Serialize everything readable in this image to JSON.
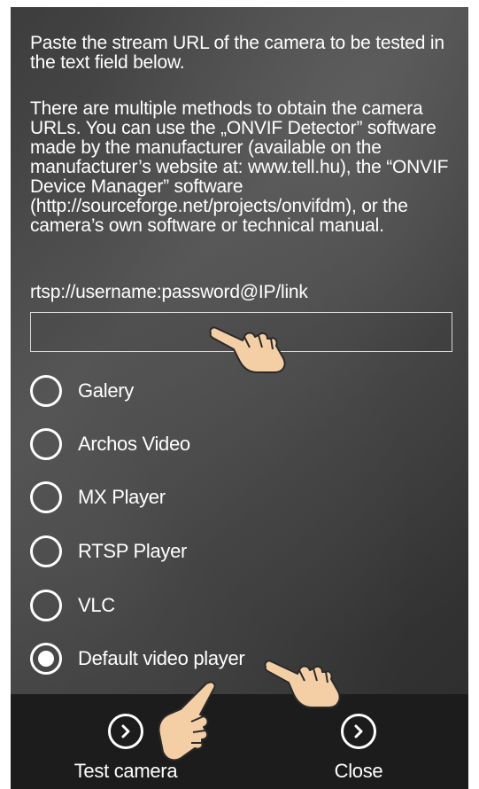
{
  "intro": {
    "text": "Paste the stream URL of the camera to be tested in the text field below."
  },
  "description": {
    "text": "There are multiple methods to obtain the camera URLs. You can use the „ONVIF Detector” software made by the manufacturer (available on the manufacturer’s website at: www.tell.hu), the “ONVIF Device Manager” software (http://sourceforge.net/projects/onvifdm), or the camera’s own software or technical manual."
  },
  "url_hint": "rtsp://username:password@IP/link",
  "url_input": {
    "value": "",
    "placeholder": ""
  },
  "player_options": [
    {
      "label": "Galery",
      "selected": false
    },
    {
      "label": "Archos Video",
      "selected": false
    },
    {
      "label": "MX Player",
      "selected": false
    },
    {
      "label": "RTSP Player",
      "selected": false
    },
    {
      "label": "VLC",
      "selected": false
    },
    {
      "label": "Default video player",
      "selected": true
    }
  ],
  "bottom_bar": {
    "test_label": "Test camera",
    "close_label": "Close",
    "icon": "chevron-right-circle-icon"
  },
  "colors": {
    "text": "#ffffff",
    "bottom_bar": "#1c1c1c",
    "background": "#404040",
    "hand_skin": "#f4cfa6"
  }
}
